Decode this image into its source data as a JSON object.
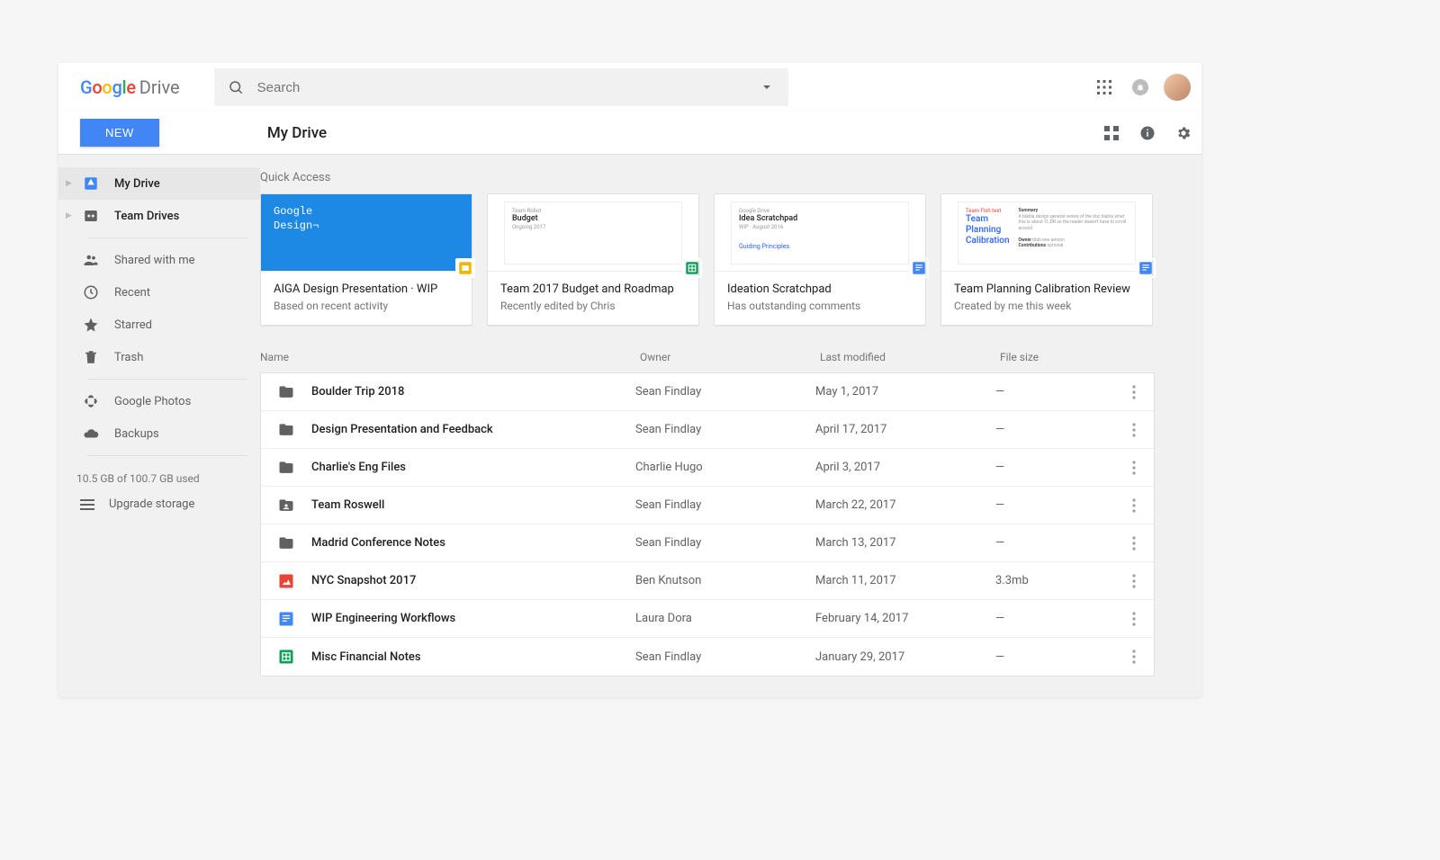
{
  "brand": {
    "name": "Google",
    "product": "Drive"
  },
  "search": {
    "placeholder": "Search"
  },
  "newButton": "NEW",
  "locationTitle": "My Drive",
  "sidebar": {
    "primary": [
      {
        "label": "My Drive",
        "selected": true,
        "icon": "drive"
      },
      {
        "label": "Team Drives",
        "selected": false,
        "icon": "team-drive"
      }
    ],
    "secondary": [
      {
        "label": "Shared with me",
        "icon": "people"
      },
      {
        "label": "Recent",
        "icon": "clock"
      },
      {
        "label": "Starred",
        "icon": "star"
      },
      {
        "label": "Trash",
        "icon": "trash"
      }
    ],
    "tertiary": [
      {
        "label": "Google Photos",
        "icon": "photos"
      },
      {
        "label": "Backups",
        "icon": "cloud"
      }
    ],
    "storage": {
      "text": "10.5 GB of 100.7 GB used",
      "upgrade": "Upgrade storage"
    }
  },
  "quickAccess": {
    "label": "Quick Access",
    "cards": [
      {
        "title": "AIGA Design Presentation · WIP",
        "subtitle": "Based on recent activity",
        "badge": "slides",
        "thumb": "Google\nDesign¬"
      },
      {
        "title": "Team 2017 Budget and Roadmap",
        "subtitle": "Recently edited by Chris",
        "badge": "sheets"
      },
      {
        "title": "Ideation Scratchpad",
        "subtitle": "Has outstanding comments",
        "badge": "docs"
      },
      {
        "title": "Team Planning Calibration Review",
        "subtitle": "Created by me this week",
        "badge": "docs"
      }
    ]
  },
  "table": {
    "headers": {
      "name": "Name",
      "owner": "Owner",
      "modified": "Last modified",
      "size": "File size"
    },
    "rows": [
      {
        "icon": "folder",
        "name": "Boulder Trip 2018",
        "owner": "Sean Findlay",
        "modified": "May 1, 2017",
        "size": "—"
      },
      {
        "icon": "folder",
        "name": "Design Presentation and Feedback",
        "owner": "Sean Findlay",
        "modified": "April 17, 2017",
        "size": "—"
      },
      {
        "icon": "folder",
        "name": "Charlie's Eng Files",
        "owner": "Charlie Hugo",
        "modified": "April 3, 2017",
        "size": "—"
      },
      {
        "icon": "shared-folder",
        "name": "Team Roswell",
        "owner": "Sean Findlay",
        "modified": "March 22, 2017",
        "size": "—"
      },
      {
        "icon": "folder",
        "name": "Madrid Conference Notes",
        "owner": "Sean Findlay",
        "modified": "March 13, 2017",
        "size": "—"
      },
      {
        "icon": "image",
        "name": "NYC Snapshot 2017",
        "owner": "Ben Knutson",
        "modified": "March 11, 2017",
        "size": "3.3mb"
      },
      {
        "icon": "docs",
        "name": "WIP Engineering Workflows",
        "owner": "Laura Dora",
        "modified": "February 14, 2017",
        "size": "—"
      },
      {
        "icon": "sheets",
        "name": "Misc Financial Notes",
        "owner": "Sean Findlay",
        "modified": "January 29, 2017",
        "size": "—"
      }
    ]
  }
}
